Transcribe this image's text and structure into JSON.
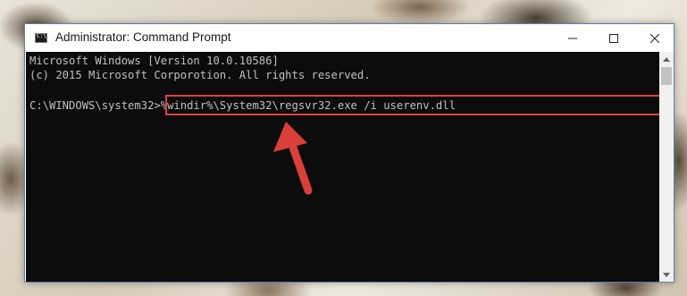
{
  "window": {
    "title": "Administrator: Command Prompt",
    "icon": "cmd-icon",
    "icon_glyph": "C:\\",
    "controls": {
      "minimize": "minimize-icon",
      "maximize": "maximize-icon",
      "close": "close-icon"
    }
  },
  "console": {
    "line1": "Microsoft Windows [Version 10.0.10586]",
    "line2": "(c) 2015 Microsoft Corporotion. All rights reserved.",
    "prompt": "C:\\WINDOWS\\system32>",
    "command": "%windir%\\System32\\regsvr32.exe /i userenv.dll",
    "text_color": "#c0c0c0",
    "background": "#0c0c0c"
  },
  "annotation": {
    "highlight_color": "#e0413b",
    "arrow_color": "#e0413b"
  }
}
